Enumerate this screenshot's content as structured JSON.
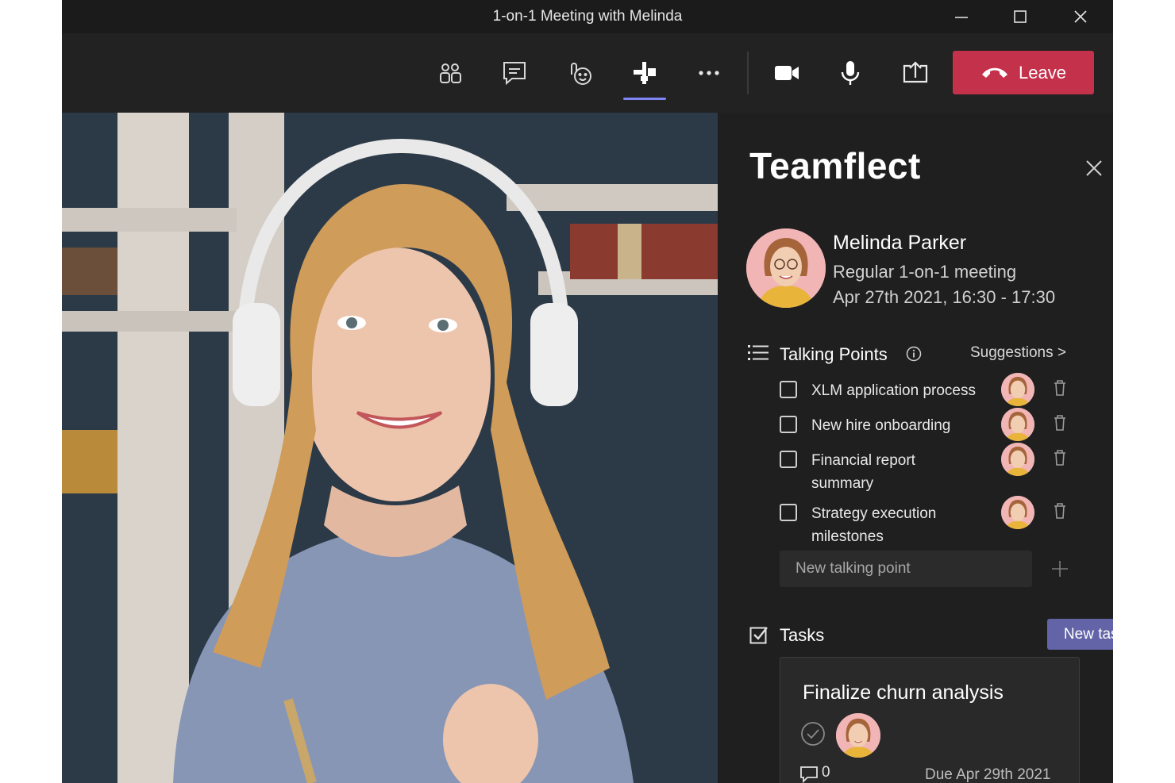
{
  "window": {
    "title": "1-on-1 Meeting with Melinda",
    "minimize_icon": "minimize-icon",
    "maximize_icon": "maximize-icon",
    "close_icon": "close-icon"
  },
  "toolbar": {
    "buttons": [
      {
        "name": "participants",
        "icon": "people-icon"
      },
      {
        "name": "chat",
        "icon": "chat-icon"
      },
      {
        "name": "reactions",
        "icon": "reactions-icon"
      },
      {
        "name": "apps",
        "icon": "apps-icon",
        "active": true
      },
      {
        "name": "more",
        "icon": "more-icon"
      },
      {
        "name": "camera",
        "icon": "camera-icon"
      },
      {
        "name": "mic",
        "icon": "mic-icon"
      },
      {
        "name": "share",
        "icon": "share-screen-icon"
      }
    ],
    "leave_label": "Leave",
    "leave_color": "#c4314b",
    "active_color": "#7f85f5"
  },
  "panel": {
    "title": "Teamflect",
    "person": {
      "name": "Melinda Parker",
      "meeting_type": "Regular 1-on-1 meeting",
      "meeting_time": "Apr 27th 2021, 16:30 - 17:30"
    },
    "talking_points": {
      "title": "Talking Points",
      "suggestions_label": "Suggestions >",
      "items": [
        {
          "text": "XLM application process"
        },
        {
          "text": "New hire onboarding"
        },
        {
          "text": "Financial report summary"
        },
        {
          "text": "Strategy execution milestones"
        }
      ],
      "new_placeholder": "New talking point"
    },
    "tasks": {
      "title": "Tasks",
      "new_task_label": "New task",
      "new_task_color": "#6264a7",
      "card": {
        "title": "Finalize churn analysis",
        "comments": "0",
        "due": "Due Apr 29th 2021"
      }
    }
  }
}
